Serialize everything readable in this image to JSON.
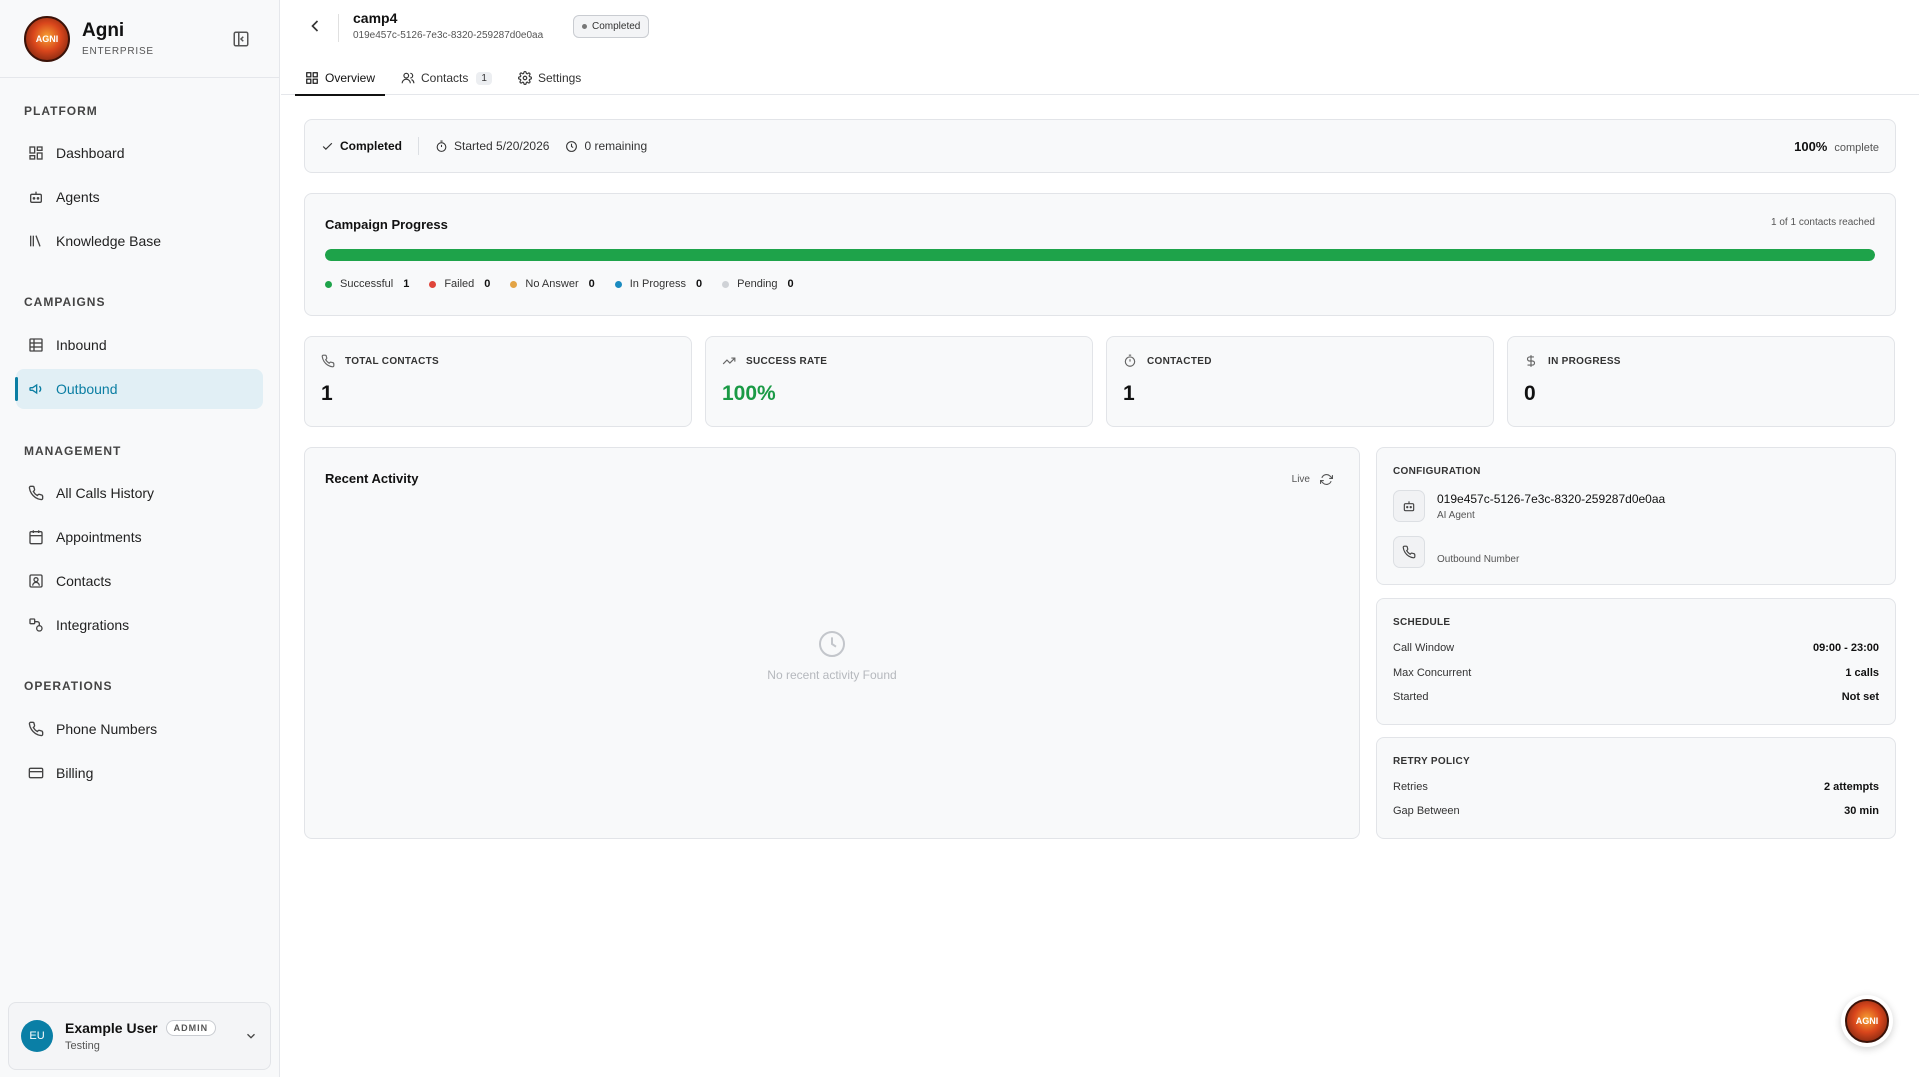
{
  "brand": {
    "name": "Agni",
    "tier": "ENTERPRISE",
    "logo_text": "AGNI"
  },
  "sidebar": {
    "sections": [
      {
        "title": "PLATFORM"
      },
      {
        "title": "CAMPAIGNS"
      },
      {
        "title": "MANAGEMENT"
      },
      {
        "title": "OPERATIONS"
      }
    ],
    "items": [
      {
        "label": "Dashboard",
        "icon": "grid-icon"
      },
      {
        "label": "Agents",
        "icon": "bot-icon"
      },
      {
        "label": "Knowledge Base",
        "icon": "library-icon"
      },
      {
        "label": "Inbound",
        "icon": "table-icon"
      },
      {
        "label": "Outbound",
        "icon": "megaphone-icon",
        "active": true
      },
      {
        "label": "All Calls History",
        "icon": "phone-icon"
      },
      {
        "label": "Appointments",
        "icon": "calendar-icon"
      },
      {
        "label": "Contacts",
        "icon": "contact-icon"
      },
      {
        "label": "Integrations",
        "icon": "plug-icon"
      },
      {
        "label": "Phone Numbers",
        "icon": "phone-icon"
      },
      {
        "label": "Billing",
        "icon": "card-icon"
      }
    ]
  },
  "user": {
    "initials": "EU",
    "name": "Example User",
    "role": "ADMIN",
    "org": "Testing"
  },
  "campaign": {
    "name": "camp4",
    "id": "019e457c-5126-7e3c-8320-259287d0e0aa",
    "status": "Completed"
  },
  "tabs": [
    {
      "label": "Overview",
      "active": true
    },
    {
      "label": "Contacts",
      "count": "1"
    },
    {
      "label": "Settings"
    }
  ],
  "status_strip": {
    "status": "Completed",
    "started": "Started 5/20/2026",
    "remaining": "0 remaining",
    "percent": "100%",
    "percent_label": "complete"
  },
  "progress": {
    "title": "Campaign Progress",
    "reached": "1 of 1 contacts reached",
    "fraction": 1.0,
    "fill_color": "#1ea34a",
    "legend": [
      {
        "label": "Successful",
        "count": "1",
        "color": "#1ea34a"
      },
      {
        "label": "Failed",
        "count": "0",
        "color": "#e0453a"
      },
      {
        "label": "No Answer",
        "count": "0",
        "color": "#e3a445"
      },
      {
        "label": "In Progress",
        "count": "0",
        "color": "#1b8bc0"
      },
      {
        "label": "Pending",
        "count": "0",
        "color": "#cfd2d6"
      }
    ]
  },
  "stats": [
    {
      "label": "TOTAL CONTACTS",
      "value": "1",
      "icon": "phone-icon"
    },
    {
      "label": "SUCCESS RATE",
      "value": "100%",
      "icon": "trending-up-icon"
    },
    {
      "label": "CONTACTED",
      "value": "1",
      "icon": "timer-icon"
    },
    {
      "label": "IN PROGRESS",
      "value": "0",
      "icon": "dollar-icon"
    }
  ],
  "activity": {
    "title": "Recent Activity",
    "live": "Live",
    "empty": "No recent activity Found"
  },
  "configuration": {
    "title": "CONFIGURATION",
    "agent_id": "019e457c-5126-7e3c-8320-259287d0e0aa",
    "agent_label": "AI Agent",
    "number_label": "Outbound Number"
  },
  "schedule": {
    "title": "SCHEDULE",
    "rows": [
      {
        "k": "Call Window",
        "v": "09:00 - 23:00"
      },
      {
        "k": "Max Concurrent",
        "v": "1 calls"
      },
      {
        "k": "Started",
        "v": "Not set"
      }
    ]
  },
  "retry": {
    "title": "RETRY POLICY",
    "rows": [
      {
        "k": "Retries",
        "v": "2 attempts"
      },
      {
        "k": "Gap Between",
        "v": "30 min"
      }
    ]
  }
}
